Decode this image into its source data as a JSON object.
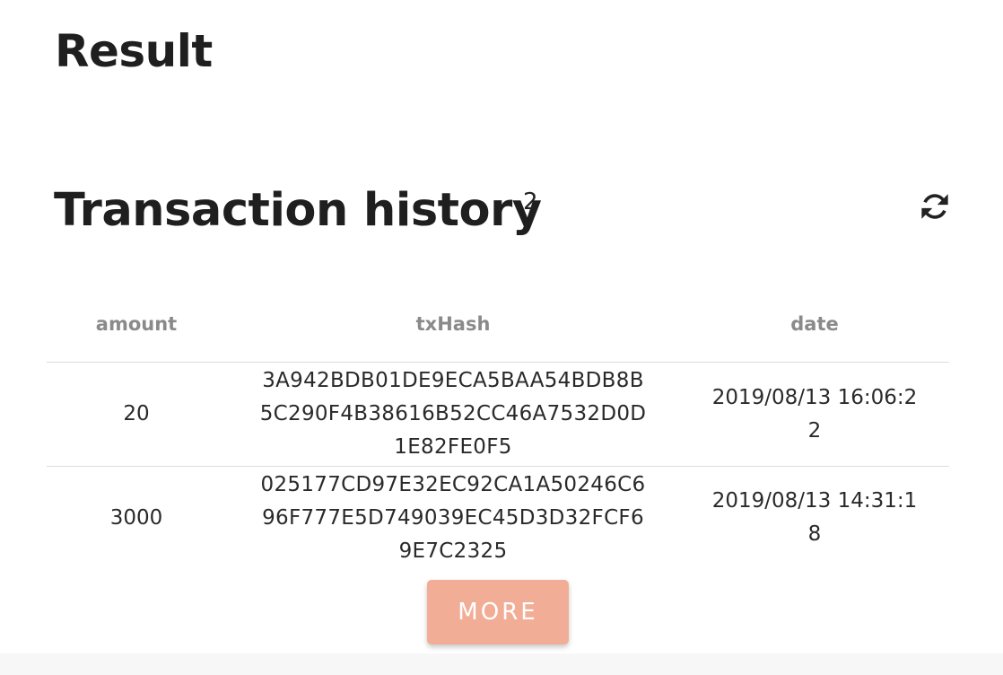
{
  "result_section": {
    "title": "Result"
  },
  "history": {
    "title": "Transaction history",
    "count": "2",
    "refresh_icon": "refresh-icon"
  },
  "table": {
    "headers": {
      "amount": "amount",
      "txhash": "txHash",
      "date": "date"
    },
    "rows": [
      {
        "amount": "20",
        "txhash": "3A942BDB01DE9ECA5BAA54BDB8B5C290F4B38616B52CC46A7532D0D1E82FE0F5",
        "date": "2019/08/13 16:06:22"
      },
      {
        "amount": "3000",
        "txhash": "025177CD97E32EC92CA1A50246C696F777E5D749039EC45D3D32FCF69E7C2325",
        "date": "2019/08/13 14:31:18"
      }
    ]
  },
  "more_button": {
    "label": "MORE",
    "color": "#f2ad96"
  }
}
